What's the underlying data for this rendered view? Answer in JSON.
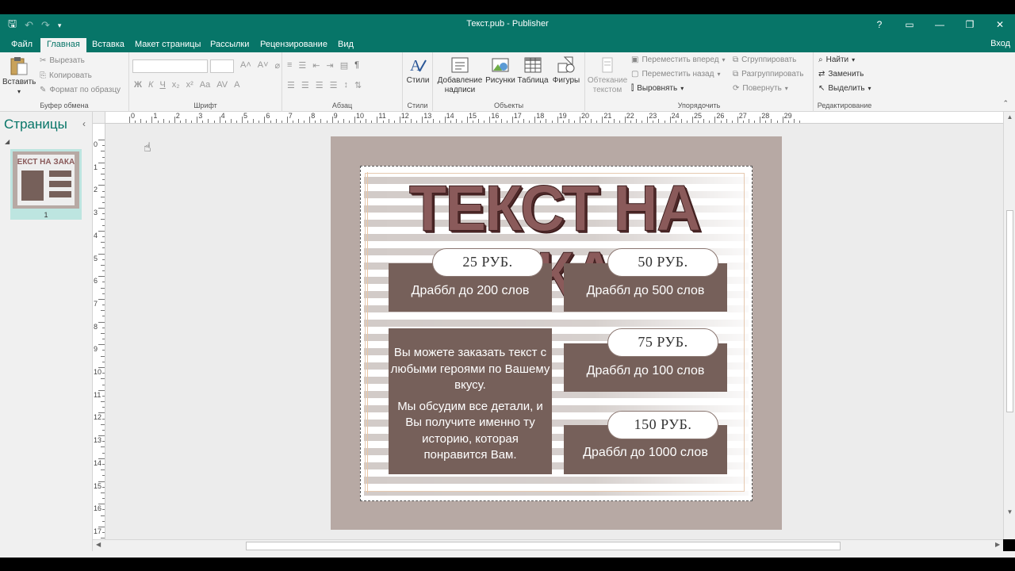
{
  "app": {
    "window_title": "Текст.pub - Publisher",
    "help": "?",
    "sign_in": "Вход"
  },
  "tabs": [
    {
      "label": "Файл"
    },
    {
      "label": "Главная"
    },
    {
      "label": "Вставка"
    },
    {
      "label": "Макет страницы"
    },
    {
      "label": "Рассылки"
    },
    {
      "label": "Рецензирование"
    },
    {
      "label": "Вид"
    }
  ],
  "ribbon": {
    "clipboard": {
      "paste": "Вставить",
      "cut": "Вырезать",
      "copy": "Копировать",
      "format_painter": "Формат по образцу",
      "group": "Буфер обмена"
    },
    "font": {
      "group": "Шрифт"
    },
    "paragraph": {
      "group": "Абзац"
    },
    "styles": {
      "label": "Стили",
      "group": "Стили"
    },
    "objects": {
      "draw_textbox": "Добавление надписи",
      "pictures": "Рисунки",
      "table": "Таблица",
      "shapes": "Фигуры",
      "group": "Объекты"
    },
    "arrange": {
      "wrap_text": "Обтекание текстом",
      "bring_forward": "Переместить вперед",
      "send_backward": "Переместить назад",
      "align": "Выровнять",
      "group_btn": "Сгруппировать",
      "ungroup": "Разгруппировать",
      "rotate": "Повернуть",
      "group": "Упорядочить"
    },
    "editing": {
      "find": "Найти",
      "replace": "Заменить",
      "select": "Выделить",
      "group": "Редактирование"
    }
  },
  "pages_pane": {
    "title": "Страницы",
    "page_number": "1"
  },
  "publication": {
    "headline": "ТЕКСТ НА ЗАКАЗ",
    "offers": [
      {
        "price": "25 РУБ.",
        "desc": "Драббл до 200 слов"
      },
      {
        "price": "50 РУБ.",
        "desc": "Драббл до 500 слов"
      },
      {
        "price": "75 РУБ.",
        "desc": "Драббл до 100 слов"
      },
      {
        "price": "150 РУБ.",
        "desc": "Драббл до 1000 слов"
      }
    ],
    "info_p1": "Вы можете заказать текст с любыми героями по Вашему вкусу.",
    "info_p2": "Мы обсудим все детали, и Вы получите именно ту историю, которая понравится Вам."
  },
  "ruler": {
    "h_labels": [
      "0",
      "1",
      "2",
      "3",
      "4",
      "5",
      "6",
      "7",
      "8",
      "9",
      "10",
      "11",
      "12",
      "13",
      "14",
      "15",
      "16",
      "17",
      "18",
      "19",
      "20",
      "21",
      "22",
      "23",
      "24",
      "25",
      "26",
      "27",
      "28",
      "29"
    ],
    "v_labels": [
      "0",
      "1",
      "2",
      "3",
      "4",
      "5",
      "6",
      "7",
      "8",
      "9",
      "10",
      "11",
      "12",
      "13",
      "14",
      "15",
      "16",
      "17"
    ]
  }
}
